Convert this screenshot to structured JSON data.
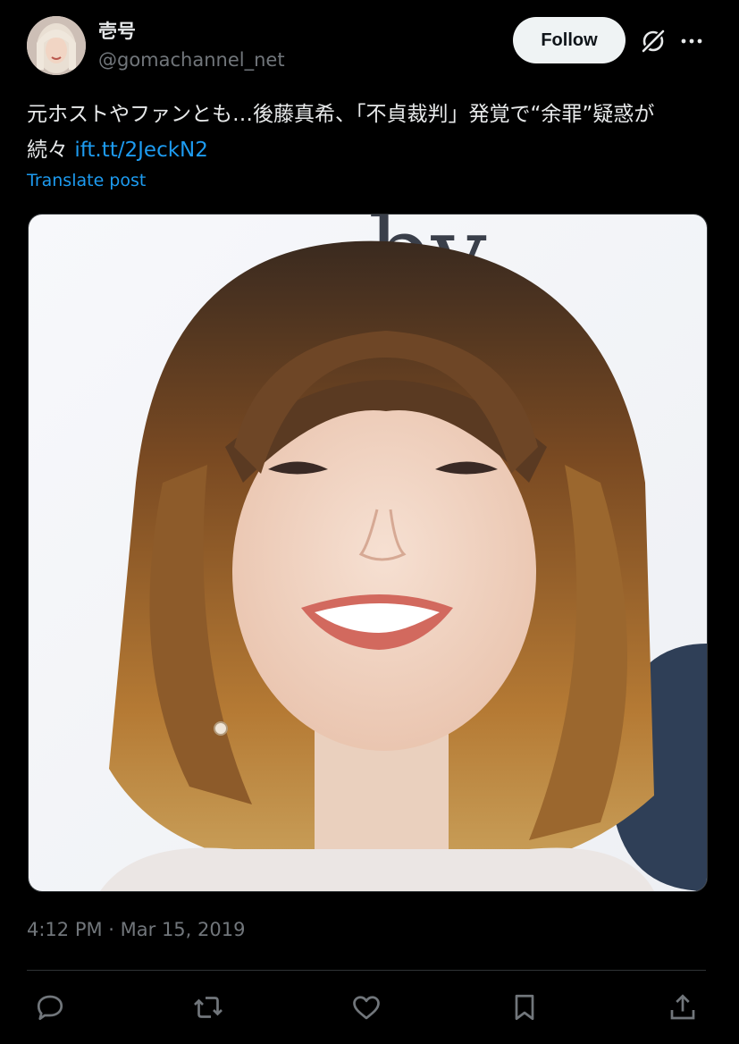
{
  "author": {
    "display_name": "壱号",
    "handle": "@gomachannel_net"
  },
  "header": {
    "follow_label": "Follow",
    "grok_icon": "grok-icon",
    "more_icon": "more-horizontal-icon"
  },
  "post": {
    "text": "元ホストやファンとも…後藤真希、「不貞裁判」発覚で“余罪”疑惑が続々 ",
    "link": "ift.tt/2JeckN2",
    "translate_label": "Translate post"
  },
  "media": {
    "photo_lettering": "by"
  },
  "meta": {
    "timestamp": "4:12 PM · Mar 15, 2019"
  },
  "actions": [
    {
      "icon": "reply-icon"
    },
    {
      "icon": "repost-icon"
    },
    {
      "icon": "like-icon"
    },
    {
      "icon": "bookmark-icon"
    },
    {
      "icon": "share-icon"
    }
  ],
  "colors": {
    "background": "#000000",
    "text": "#e7e9ea",
    "secondary": "#71767b",
    "link": "#1d9bf0",
    "follow_button_bg": "#eff3f4"
  }
}
